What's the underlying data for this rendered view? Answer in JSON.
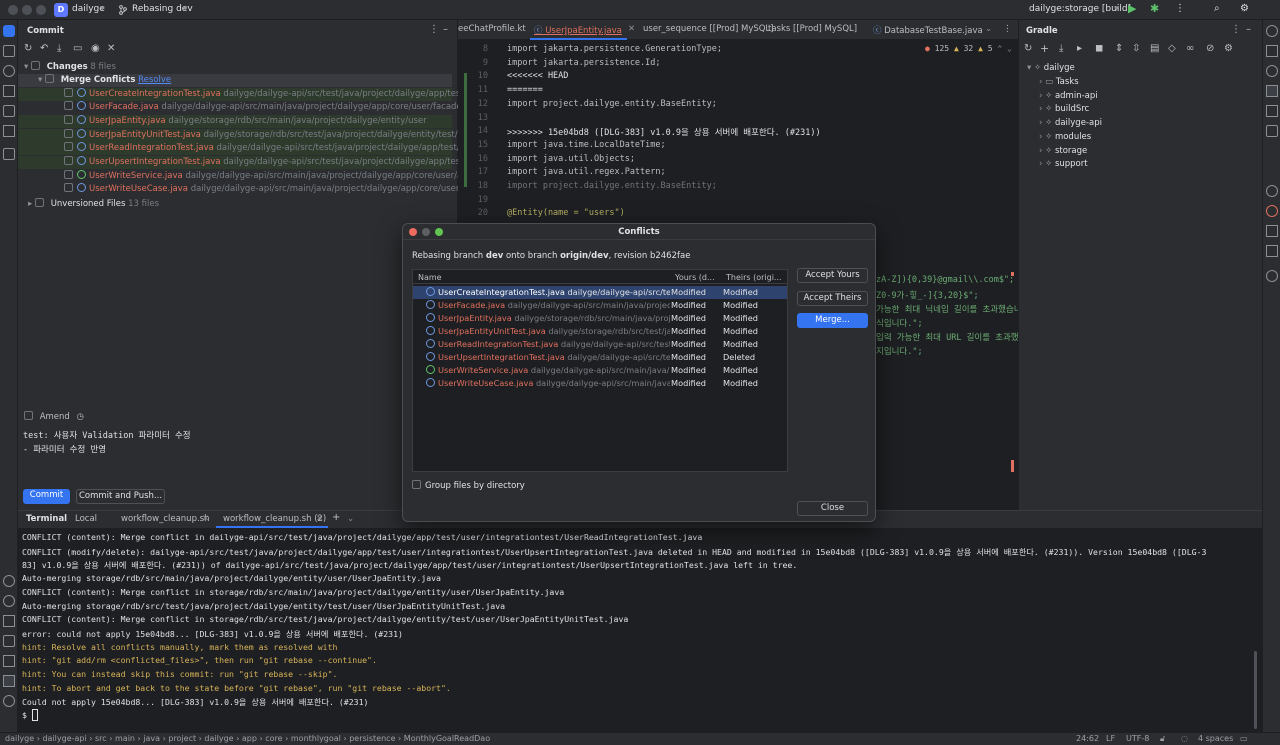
{
  "titlebar": {
    "project_badge": "D",
    "project_name": "dailyge",
    "branch": "Rebasing dev",
    "run_config": "dailyge:storage [build]"
  },
  "commit_panel": {
    "title": "Commit",
    "changes_label": "Changes",
    "changes_count": "8 files",
    "merge_conflicts_label": "Merge Conflicts",
    "resolve_link": "Resolve",
    "files": [
      {
        "name": "UserCreateIntegrationTest.java",
        "path": "dailyge/dailyge-api/src/test/java/project/dailyge/app/test/user/in"
      },
      {
        "name": "UserFacade.java",
        "path": "dailyge/dailyge-api/src/main/java/project/dailyge/app/core/user/facade"
      },
      {
        "name": "UserJpaEntity.java",
        "path": "dailyge/storage/rdb/src/main/java/project/dailyge/entity/user"
      },
      {
        "name": "UserJpaEntityUnitTest.java",
        "path": "dailyge/storage/rdb/src/test/java/project/dailyge/entity/test/user"
      },
      {
        "name": "UserReadIntegrationTest.java",
        "path": "dailyge/dailyge-api/src/test/java/project/dailyge/app/test/user/inte"
      },
      {
        "name": "UserUpsertIntegrationTest.java",
        "path": "dailyge/dailyge-api/src/test/java/project/dailyge/app/test/user/int"
      },
      {
        "name": "UserWriteService.java",
        "path": "dailyge/dailyge-api/src/main/java/project/dailyge/app/core/user/applicati"
      },
      {
        "name": "UserWriteUseCase.java",
        "path": "dailyge/dailyge-api/src/main/java/project/dailyge/app/core/user/applicat"
      }
    ],
    "unversioned_label": "Unversioned Files",
    "unversioned_count": "13 files",
    "amend_label": "Amend",
    "commit_message_line1": "test: 사용자 Validation 파라미터 수정",
    "commit_message_line2": "- 파라미터 수정 반영",
    "commit_button": "Commit",
    "commit_push_button": "Commit and Push..."
  },
  "editor": {
    "tabs": [
      "eeChatProfile.kt",
      "UserJpaEntity.java",
      "user_sequence [[Prod] MySQL]",
      "tasks [[Prod] MySQL]",
      "DatabaseTestBase.java"
    ],
    "inspection": {
      "errors": "125",
      "warnings": "32",
      "weak": "5"
    },
    "lines": [
      {
        "n": "8",
        "t": "import jakarta.persistence.GenerationType;"
      },
      {
        "n": "9",
        "t": "import jakarta.persistence.Id;"
      },
      {
        "n": "10",
        "t": "<<<<<<< HEAD"
      },
      {
        "n": "11",
        "t": "======="
      },
      {
        "n": "12",
        "t": "import project.dailyge.entity.BaseEntity;"
      },
      {
        "n": "13",
        "t": ""
      },
      {
        "n": "14",
        "t": ">>>>>>> 15e04bd8 ([DLG-383] v1.0.9을 상용 서버에 배포한다. (#231))"
      },
      {
        "n": "15",
        "t": "import java.time.LocalDateTime;"
      },
      {
        "n": "16",
        "t": "import java.util.Objects;"
      },
      {
        "n": "17",
        "t": "import java.util.regex.Pattern;"
      },
      {
        "n": "18",
        "t": "import project.dailyge.entity.BaseEntity;"
      },
      {
        "n": "19",
        "t": ""
      },
      {
        "n": "20",
        "t": "@Entity(name = \"users\")"
      }
    ],
    "partial_lines": [
      "zA-Z]){0,39}@gmail\\\\.com$\";",
      "Z0-9가-힣_-]{3,20}$\";",
      "가능한 최대 닉네임 길이를 초과했습니",
      "식입니다.\";",
      "입력 가능한 최대 URL 길이를 초과했습니",
      "지입니다.\";"
    ]
  },
  "gradle": {
    "title": "Gradle",
    "root": "dailyge",
    "items": [
      "Tasks",
      "admin-api",
      "buildSrc",
      "dailyge-api",
      "modules",
      "storage",
      "support"
    ]
  },
  "terminal": {
    "tabs": [
      "Terminal",
      "Local",
      "workflow_cleanup.sh",
      "workflow_cleanup.sh (2)"
    ],
    "lines": [
      {
        "t": "CONFLICT (content): Merge conflict in dailyge-api/src/test/java/project/dailyge/app/test/user/integrationtest/UserReadIntegrationTest.java",
        "k": "n"
      },
      {
        "t": "CONFLICT (modify/delete): dailyge-api/src/test/java/project/dailyge/app/test/user/integrationtest/UserUpsertIntegrationTest.java deleted in HEAD and modified in 15e04bd8 ([DLG-383] v1.0.9을 상용 서버에 배포한다. (#231)).  Version 15e04bd8 ([DLG-3",
        "k": "n"
      },
      {
        "t": "83] v1.0.9을 상용 서버에 배포한다. (#231)) of dailyge-api/src/test/java/project/dailyge/app/test/user/integrationtest/UserUpsertIntegrationTest.java left in tree.",
        "k": "n"
      },
      {
        "t": "Auto-merging storage/rdb/src/main/java/project/dailyge/entity/user/UserJpaEntity.java",
        "k": "n"
      },
      {
        "t": "CONFLICT (content): Merge conflict in storage/rdb/src/main/java/project/dailyge/entity/user/UserJpaEntity.java",
        "k": "n"
      },
      {
        "t": "Auto-merging storage/rdb/src/test/java/project/dailyge/entity/test/user/UserJpaEntityUnitTest.java",
        "k": "n"
      },
      {
        "t": "CONFLICT (content): Merge conflict in storage/rdb/src/test/java/project/dailyge/entity/test/user/UserJpaEntityUnitTest.java",
        "k": "n"
      },
      {
        "t": "error: could not apply 15e04bd8... [DLG-383] v1.0.9을 상용 서버에 배포한다. (#231)",
        "k": "n"
      },
      {
        "t": "hint: Resolve all conflicts manually, mark them as resolved with",
        "k": "h"
      },
      {
        "t": "hint: \"git add/rm <conflicted_files>\", then run \"git rebase --continue\".",
        "k": "h"
      },
      {
        "t": "hint: You can instead skip this commit: run \"git rebase --skip\".",
        "k": "h"
      },
      {
        "t": "hint: To abort and get back to the state before \"git rebase\", run \"git rebase --abort\".",
        "k": "h"
      },
      {
        "t": "Could not apply 15e04bd8... [DLG-383] v1.0.9을 상용 서버에 배포한다. (#231)",
        "k": "n"
      },
      {
        "t": "$",
        "k": "n"
      }
    ]
  },
  "statusbar": {
    "breadcrumbs": [
      "dailyge",
      "dailyge-api",
      "src",
      "main",
      "java",
      "project",
      "dailyge",
      "app",
      "core",
      "monthlygoal",
      "persistence",
      "MonthlyGoalReadDao"
    ],
    "position": "24:62",
    "line_sep": "LF",
    "encoding": "UTF-8",
    "indent": "4 spaces"
  },
  "dialog": {
    "title": "Conflicts",
    "subtitle_prefix": "Rebasing branch",
    "subtitle_branch": "dev",
    "subtitle_mid": "onto branch",
    "subtitle_target": "origin/dev",
    "subtitle_suffix": ", revision b2462fae",
    "columns": [
      "Name",
      "Yours (d...",
      "Theirs (origi..."
    ],
    "rows": [
      {
        "name": "UserCreateIntegrationTest.java",
        "path": "dailyge/dailyge-api/src/test/ja",
        "yours": "Modified",
        "theirs": "Modified"
      },
      {
        "name": "UserFacade.java",
        "path": "dailyge/dailyge-api/src/main/java/project/c",
        "yours": "Modified",
        "theirs": "Modified"
      },
      {
        "name": "UserJpaEntity.java",
        "path": "dailyge/storage/rdb/src/main/java/projec",
        "yours": "Modified",
        "theirs": "Modified"
      },
      {
        "name": "UserJpaEntityUnitTest.java",
        "path": "dailyge/storage/rdb/src/test/java/",
        "yours": "Modified",
        "theirs": "Modified"
      },
      {
        "name": "UserReadIntegrationTest.java",
        "path": "dailyge/dailyge-api/src/test/ja",
        "yours": "Modified",
        "theirs": "Modified"
      },
      {
        "name": "UserUpsertIntegrationTest.java",
        "path": "dailyge/dailyge-api/src/test/",
        "yours": "Modified",
        "theirs": "Deleted"
      },
      {
        "name": "UserWriteService.java",
        "path": "dailyge/dailyge-api/src/main/java/pro",
        "yours": "Modified",
        "theirs": "Modified"
      },
      {
        "name": "UserWriteUseCase.java",
        "path": "dailyge/dailyge-api/src/main/java/pr",
        "yours": "Modified",
        "theirs": "Modified"
      }
    ],
    "accept_yours": "Accept Yours",
    "accept_theirs": "Accept Theirs",
    "merge": "Merge...",
    "group_by_dir": "Group files by directory",
    "close": "Close"
  },
  "colors": {
    "accent": "#3574f0",
    "conflict_red": "#e0705f",
    "hint": "#d8b45a",
    "string": "#6aab73",
    "keyword": "#cf8e6d"
  }
}
